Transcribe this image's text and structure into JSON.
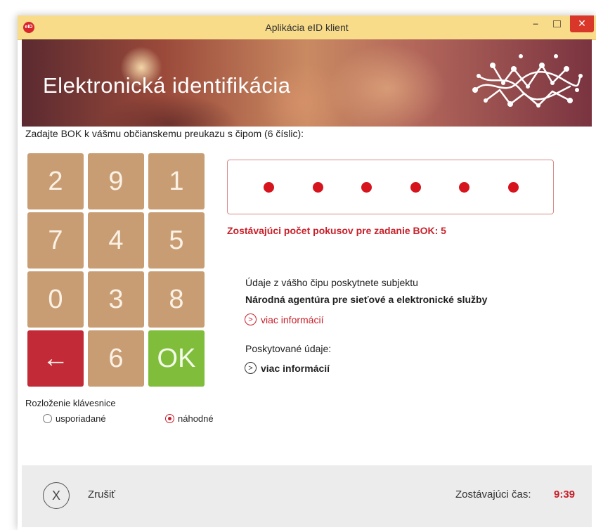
{
  "window": {
    "title": "Aplikácia eID klient",
    "app_icon_text": "eID",
    "minimize": "–",
    "close": "✕"
  },
  "banner": {
    "title": "Elektronická identifikácia"
  },
  "instruction": "Zadajte BOK k vášmu občianskemu preukazu s čipom (6 číslic):",
  "keypad": {
    "keys": [
      "2",
      "9",
      "1",
      "7",
      "4",
      "5",
      "0",
      "3",
      "8",
      "←",
      "6",
      "OK"
    ]
  },
  "pin": {
    "length": 6,
    "entered": 6
  },
  "attempts_text": "Zostávajúci počet pokusov pre zadanie BOK: 5",
  "provider": {
    "intro": "Údaje z vášho čipu poskytnete subjektu",
    "name": "Národná agentúra pre sieťové a elektronické služby",
    "more": "viac informácií"
  },
  "provided_data": {
    "label": "Poskytované údaje:",
    "more": "viac informácií"
  },
  "layout": {
    "label": "Rozloženie klávesnice",
    "options": [
      "usporiadané",
      "náhodné"
    ],
    "selected": "náhodné"
  },
  "footer": {
    "cancel_icon": "X",
    "cancel_label": "Zrušiť",
    "time_label": "Zostávajúci čas:",
    "time_value": "9:39"
  },
  "colors": {
    "accent_red": "#c8202a",
    "key_tan": "#c89d73",
    "key_back": "#c22a38",
    "key_ok": "#7fbd3b",
    "titlebar": "#f9dc8a"
  }
}
